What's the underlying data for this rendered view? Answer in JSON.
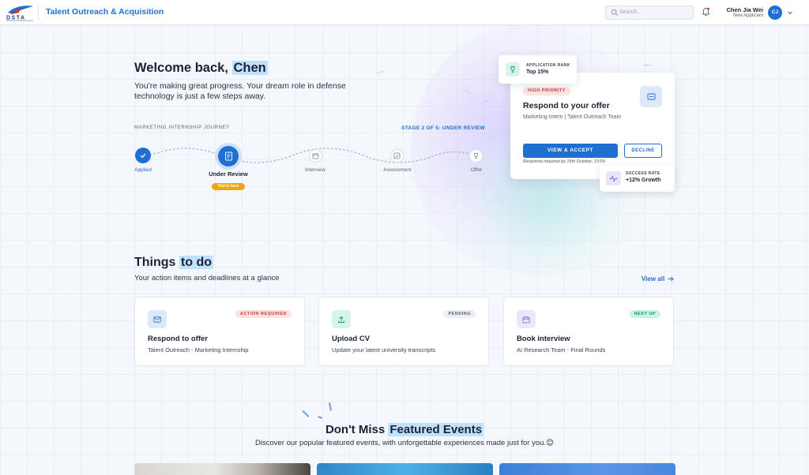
{
  "header": {
    "logo_text": "DSTA",
    "app_title": "Talent Outreach & Acquisition",
    "search_placeholder": "Search...",
    "user_name": "Chen Jia Wei",
    "user_role": "New Applicant",
    "avatar_initials": "CJ"
  },
  "hero": {
    "welcome_prefix": "Welcome back,",
    "welcome_name": "Chen",
    "subtitle": "You're making great progress. Your dream role in defense technology is just a few steps away.",
    "journey_label": "MARKETING INTERNSHIP JOURNEY",
    "stage_label": "STAGE 2 OF 5: UNDER REVIEW",
    "steps": [
      {
        "label": "Applied",
        "state": "done",
        "icon": "check-icon"
      },
      {
        "label": "Under Review",
        "state": "current",
        "icon": "document-icon"
      },
      {
        "label": "Interview",
        "state": "upcoming",
        "icon": "calendar-icon"
      },
      {
        "label": "Assessment",
        "state": "upcoming",
        "icon": "checklist-icon"
      },
      {
        "label": "Offer",
        "state": "upcoming",
        "icon": "trophy-icon"
      }
    ],
    "current_marker": "You're here"
  },
  "rank_card": {
    "label": "APPLICATION RANK",
    "value": "Top 15%",
    "icon": "trophy-icon"
  },
  "offer_card": {
    "priority": "HIGH PRIORITY",
    "title": "Respond to your offer",
    "subtitle": "Marketing Intern | Talent Outreach Team",
    "accept_label": "VIEW & ACCEPT",
    "decline_label": "DECLINE",
    "deadline": "Response required by 15th October, 23:59",
    "icon": "mail-icon"
  },
  "growth_card": {
    "label": "SUCCESS RATE",
    "value": "+12% Growth",
    "icon": "pulse-icon"
  },
  "todo": {
    "title_prefix": "Things",
    "title_highlight": "to do",
    "subtitle": "Your action items and deadlines at a glance",
    "view_all": "View all",
    "tasks": [
      {
        "title": "Respond to offer",
        "subtitle": "Talent Outreach - Marketing Internship",
        "badge": "ACTION REQUIRED",
        "icon": "mail-icon",
        "badge_color": "#c73b3b"
      },
      {
        "title": "Upload CV",
        "subtitle": "Update your latest university transcripts",
        "badge": "PENDING",
        "icon": "upload-icon",
        "badge_color": "#5b6577"
      },
      {
        "title": "Book interview",
        "subtitle": "AI Research Team - Final Rounds",
        "badge": "NEXT UP",
        "icon": "calendar-icon",
        "badge_color": "#0f8f7a"
      }
    ]
  },
  "events": {
    "title_prefix": "Don't Miss",
    "title_highlight": "Featured Events",
    "subtitle": "Discover our popular featured events, with unforgettable experiences made just for you.",
    "emoji": "😊"
  },
  "colors": {
    "accent": "#1f6fd0",
    "highlight": "#bfe0ff",
    "current_marker": "#f2a60d"
  }
}
